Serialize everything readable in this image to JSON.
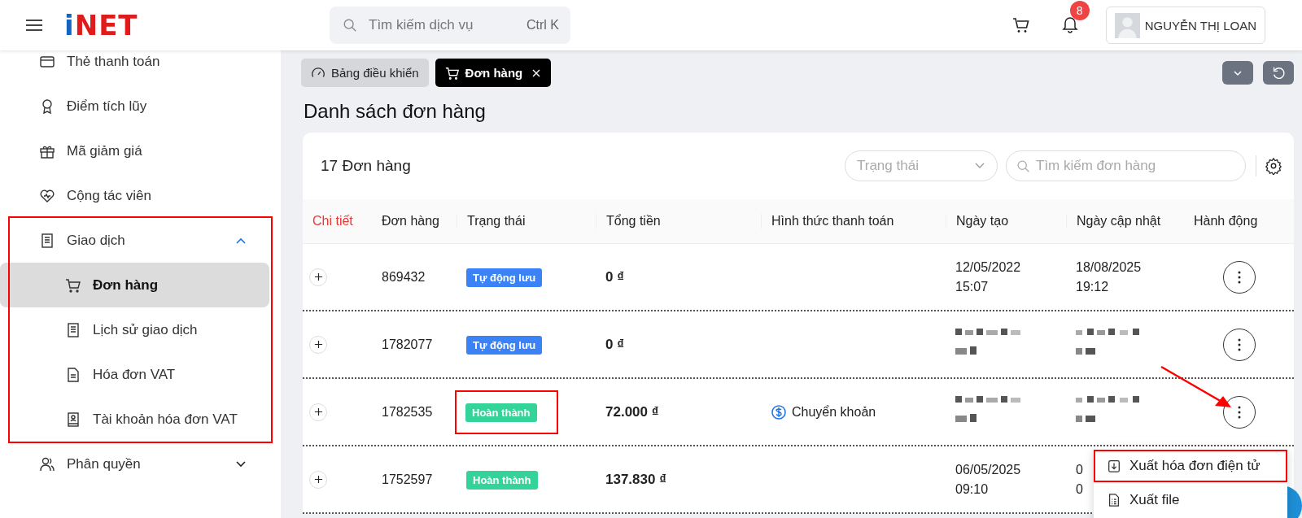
{
  "header": {
    "logo": [
      "i",
      "N",
      "E",
      "T"
    ],
    "search": {
      "placeholder": "Tìm kiếm dịch vụ",
      "shortcut": "Ctrl K"
    },
    "notifications": "8",
    "user": "NGUYỄN THỊ LOAN"
  },
  "sidebar": {
    "items": [
      {
        "label": "Thẻ thanh toán",
        "selected": false
      },
      {
        "label": "Điểm tích lũy",
        "selected": false
      },
      {
        "label": "Mã giảm giá",
        "selected": false
      },
      {
        "label": "Cộng tác viên",
        "selected": false
      },
      {
        "label": "Giao dịch",
        "selected": false,
        "expanded": true,
        "highlighted": true,
        "children": [
          {
            "label": "Đơn hàng",
            "selected": true
          },
          {
            "label": "Lịch sử giao dịch",
            "selected": false
          },
          {
            "label": "Hóa đơn VAT",
            "selected": false
          },
          {
            "label": "Tài khoản hóa đơn VAT",
            "selected": false
          }
        ]
      },
      {
        "label": "Phân quyền",
        "selected": false,
        "expanded": false
      }
    ]
  },
  "tabs": [
    {
      "label": "Bảng điều khiển",
      "selected": false,
      "closable": false
    },
    {
      "label": "Đơn hàng",
      "selected": true,
      "closable": true
    }
  ],
  "page_title": "Danh sách đơn hàng",
  "card": {
    "count": "17 Đơn hàng",
    "status_filter": {
      "placeholder": "Trạng thái"
    },
    "search": {
      "placeholder": "Tìm kiếm đơn hàng"
    }
  },
  "table": {
    "columns": [
      "Chi tiết",
      "Đơn hàng",
      "Trạng thái",
      "Tổng tiền",
      "Hình thức thanh toán",
      "Ngày tạo",
      "Ngày cập nhật",
      "Hành động"
    ],
    "rows": [
      {
        "id": "869432",
        "status": {
          "label": "Tự động lưu",
          "color": "#3b82f6"
        },
        "total": "0 ₫",
        "payment": "",
        "created": [
          "12/05/2022",
          "15:07"
        ],
        "updated": [
          "18/08/2025",
          "19:12"
        ],
        "redacted": false,
        "highlighted": false,
        "menu_open": false
      },
      {
        "id": "1782077",
        "status": {
          "label": "Tự động lưu",
          "color": "#3b82f6"
        },
        "total": "0 ₫",
        "payment": "",
        "redacted": true,
        "highlighted": false,
        "menu_open": false
      },
      {
        "id": "1782535",
        "status": {
          "label": "Hoàn thành",
          "color": "#34d399"
        },
        "total": "72.000 ₫",
        "payment": "Chuyển khoản",
        "redacted": true,
        "highlighted": true,
        "menu_open": true
      },
      {
        "id": "1752597",
        "status": {
          "label": "Hoàn thành",
          "color": "#34d399"
        },
        "total": "137.830 ₫",
        "payment": "",
        "created": [
          "06/05/2025",
          "09:10"
        ],
        "updated": [
          "0",
          "0"
        ],
        "redacted": false,
        "highlighted": false
      }
    ]
  },
  "action_menu": {
    "items": [
      {
        "label": "Xuất hóa đơn điện tử",
        "highlighted": true
      },
      {
        "label": "Xuất file",
        "highlighted": false
      }
    ]
  }
}
